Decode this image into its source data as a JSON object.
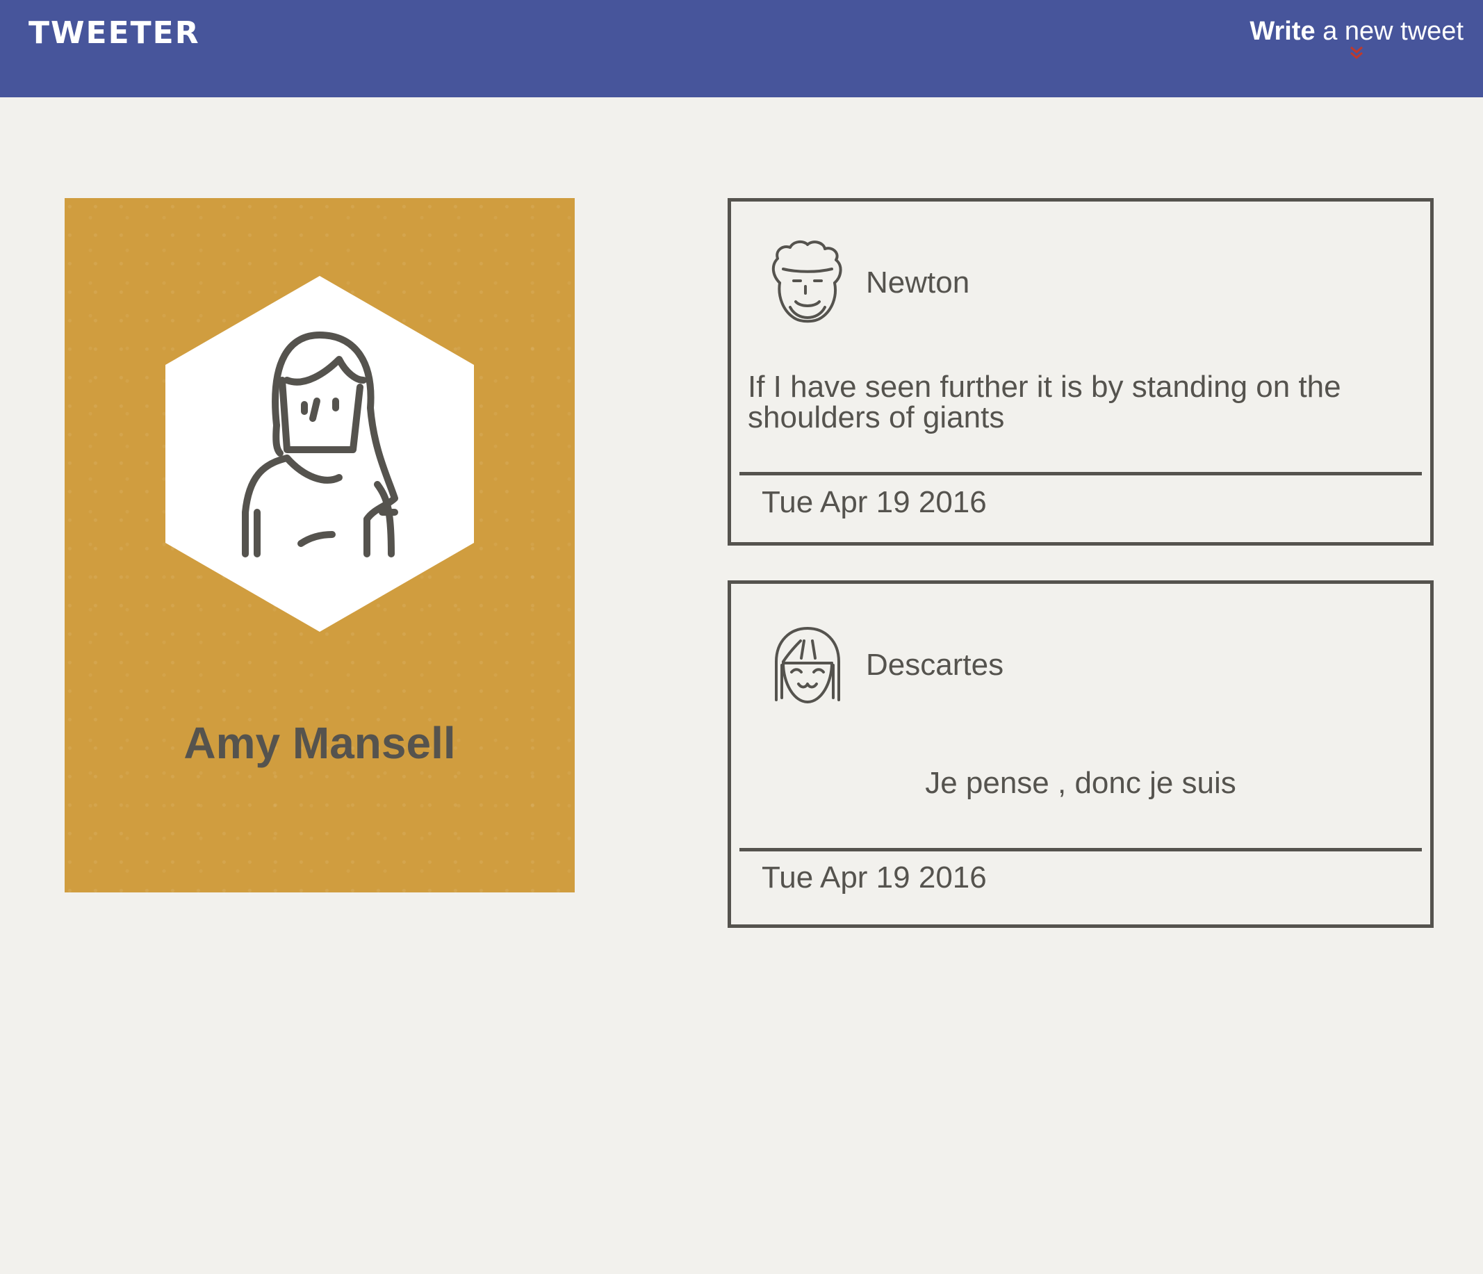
{
  "navbar": {
    "brand": "TWEETER",
    "compose_bold": "Write",
    "compose_rest": " a new tweet",
    "color": "#47559b",
    "chevron_color": "#c0392b"
  },
  "profile": {
    "name": "Amy Mansell",
    "background": "#d09d3f",
    "avatar_icon": "woman-avatar-icon"
  },
  "tweets": [
    {
      "author": "Newton",
      "avatar_icon": "curly-hair-man-avatar-icon",
      "text": "If I have seen further it is by standing on the shoulders of giants",
      "date": "Tue Apr 19 2016"
    },
    {
      "author": "Descartes",
      "avatar_icon": "bob-hair-smiling-avatar-icon",
      "text": "Je pense , donc je suis",
      "date": "Tue Apr 19 2016"
    }
  ]
}
